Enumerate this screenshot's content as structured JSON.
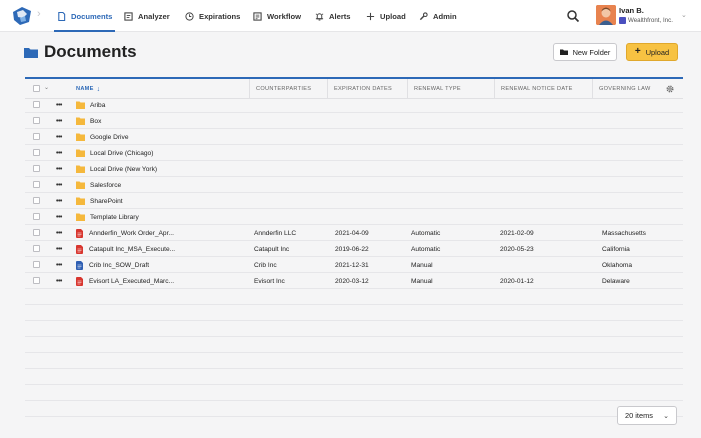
{
  "nav": {
    "items": [
      {
        "label": "Documents",
        "icon": "document-icon",
        "active": true
      },
      {
        "label": "Analyzer",
        "icon": "analyzer-icon"
      },
      {
        "label": "Expirations",
        "icon": "clock-icon"
      },
      {
        "label": "Workflow",
        "icon": "workflow-icon"
      },
      {
        "label": "Alerts",
        "icon": "alert-icon"
      },
      {
        "label": "Upload",
        "icon": "plus-icon"
      },
      {
        "label": "Admin",
        "icon": "wrench-icon"
      }
    ],
    "user": {
      "name": "Ivan B.",
      "org": "Wealthfront, Inc."
    }
  },
  "page": {
    "title": "Documents",
    "new_folder_label": "New Folder",
    "upload_label": "Upload"
  },
  "table": {
    "columns": {
      "name": "NAME",
      "counterparties": "COUNTERPARTIES",
      "expiration": "EXPIRATION DATES",
      "renewal_type": "RENEWAL TYPE",
      "renewal_notice": "RENEWAL NOTICE DATE",
      "law": "GOVERNING LAW"
    },
    "folders": [
      {
        "name": "Ariba"
      },
      {
        "name": "Box"
      },
      {
        "name": "Google Drive"
      },
      {
        "name": "Local Drive (Chicago)"
      },
      {
        "name": "Local Drive (New York)"
      },
      {
        "name": "Salesforce"
      },
      {
        "name": "SharePoint"
      },
      {
        "name": "Template Library"
      }
    ],
    "documents": [
      {
        "name": "Annderfin_Work Order_Apr...",
        "type": "pdf",
        "counterparty": "Annderfin LLC",
        "expiration": "2021-04-09",
        "renewal_type": "Automatic",
        "renewal_notice": "2021-02-09",
        "law": "Massachusetts"
      },
      {
        "name": "Catapult Inc_MSA_Execute...",
        "type": "pdf",
        "counterparty": "Catapult Inc",
        "expiration": "2019-06-22",
        "renewal_type": "Automatic",
        "renewal_notice": "2020-05-23",
        "law": "California"
      },
      {
        "name": "Crib Inc_SOW_Draft",
        "type": "word",
        "counterparty": "Crib Inc",
        "expiration": "2021-12-31",
        "renewal_type": "Manual",
        "renewal_notice": "",
        "law": "Oklahoma"
      },
      {
        "name": "Evisort LA_Executed_Marc...",
        "type": "pdf",
        "counterparty": "Evisort Inc",
        "expiration": "2020-03-12",
        "renewal_type": "Manual",
        "renewal_notice": "2020-01-12",
        "law": "Delaware"
      }
    ]
  },
  "pager": {
    "label": "20 items"
  },
  "colors": {
    "accent": "#2d69b7",
    "upload": "#f7c242",
    "folder": "#f5b83c",
    "pdf": "#d8362f",
    "word": "#2f5fb3"
  }
}
